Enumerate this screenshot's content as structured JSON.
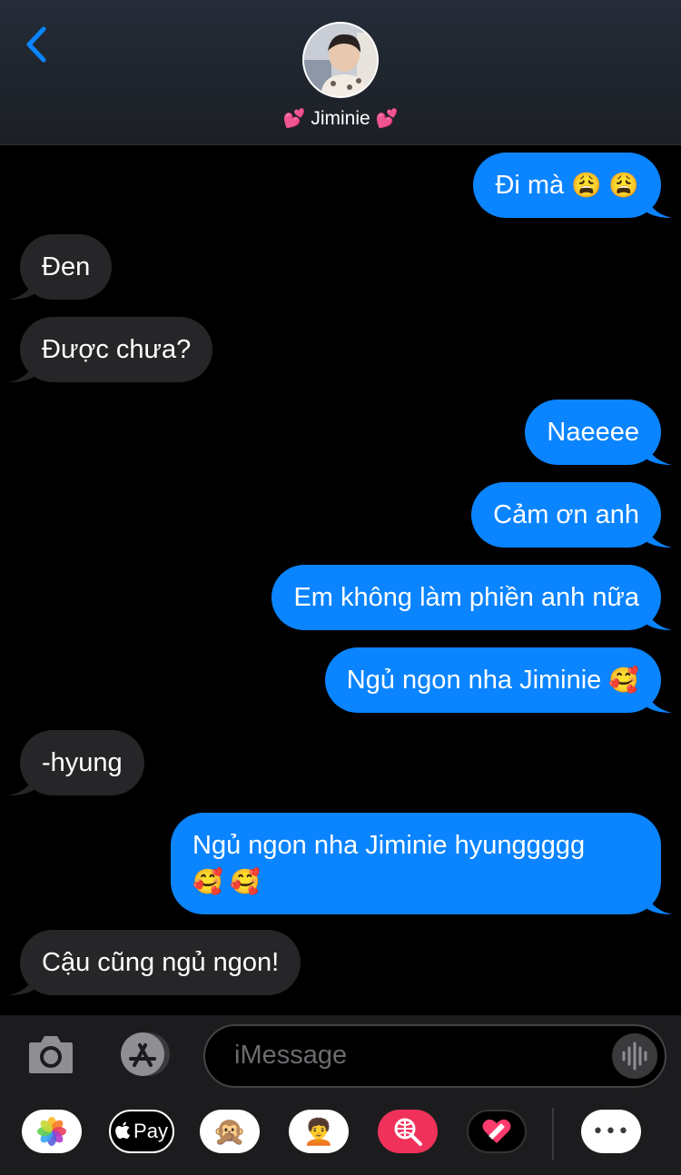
{
  "header": {
    "contact_name": "Jiminie",
    "name_prefix_emoji": "💕",
    "name_suffix_emoji": "💕"
  },
  "messages": [
    {
      "side": "out",
      "text": "Đi mà",
      "emoji": "😩 😩"
    },
    {
      "side": "in",
      "text": "Đen"
    },
    {
      "side": "in",
      "text": "Được chưa?"
    },
    {
      "side": "out",
      "text": "Naeeee"
    },
    {
      "side": "out",
      "text": "Cảm ơn anh"
    },
    {
      "side": "out",
      "text": "Em không làm phiền anh nữa"
    },
    {
      "side": "out",
      "text": "Ngủ ngon nha Jiminie",
      "emoji": "🥰"
    },
    {
      "side": "in",
      "text": "-hyung"
    },
    {
      "side": "out",
      "text": "Ngủ ngon nha Jiminie hyunggggg",
      "emoji": "🥰 🥰"
    },
    {
      "side": "in",
      "text": "Cậu cũng ngủ ngon!"
    }
  ],
  "input": {
    "placeholder": "iMessage"
  },
  "apps": {
    "apple_pay_label": "Pay",
    "animoji_emoji": "🙊",
    "memoji_emoji": "🧑‍🦱",
    "more_label": "•••"
  },
  "colors": {
    "outgoing": "#0a84ff",
    "incoming": "#262629",
    "accent": "#0a84ff"
  }
}
